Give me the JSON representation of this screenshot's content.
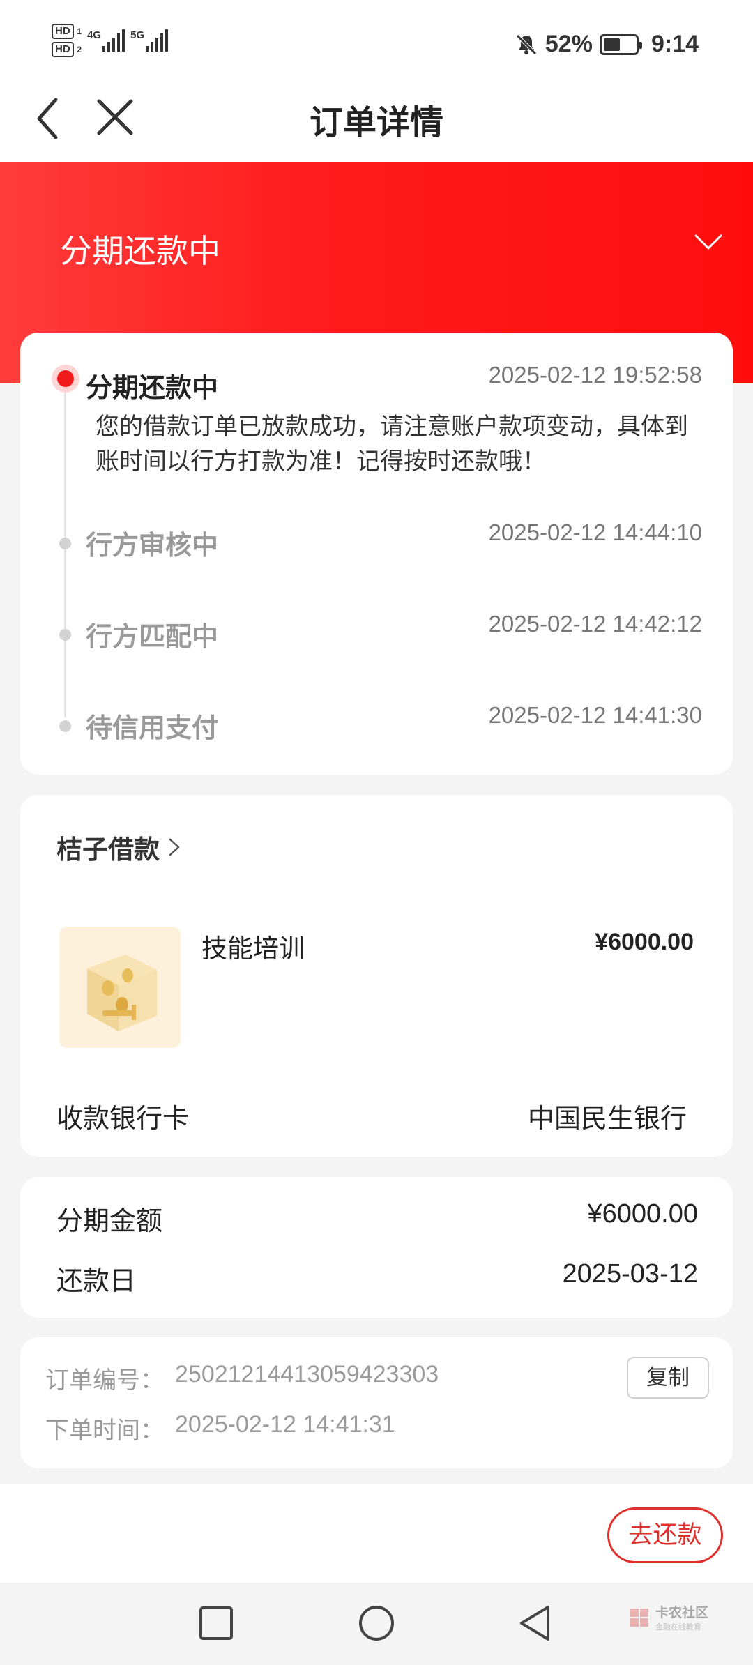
{
  "status_bar": {
    "hd1": "HD",
    "hd1_idx": "1",
    "hd2": "HD",
    "hd2_idx": "2",
    "net1": "4G",
    "net2": "5G",
    "battery": "52%",
    "time": "9:14"
  },
  "nav": {
    "title": "订单详情"
  },
  "hero": {
    "status": "分期还款中"
  },
  "timeline": [
    {
      "title": "分期还款中",
      "time": "2025-02-12 19:52:58",
      "desc": "您的借款订单已放款成功，请注意账户款项变动，具体到账时间以行方打款为准！记得按时还款哦！"
    },
    {
      "title": "行方审核中",
      "time": "2025-02-12 14:44:10"
    },
    {
      "title": "行方匹配中",
      "time": "2025-02-12 14:42:12"
    },
    {
      "title": "待信用支付",
      "time": "2025-02-12 14:41:30"
    }
  ],
  "product": {
    "merchant": "桔子借款",
    "name": "技能培训",
    "price": "¥6000.00",
    "bank_label": "收款银行卡",
    "bank_value": "中国民生银行"
  },
  "installment": {
    "amount_label": "分期金额",
    "amount_value": "¥6000.00",
    "due_label": "还款日",
    "due_value": "2025-03-12"
  },
  "order": {
    "number_label": "订单编号：",
    "number_value": "25021214413059423303",
    "time_label": "下单时间：",
    "time_value": "2025-02-12 14:41:31",
    "copy_label": "复制"
  },
  "actions": {
    "repay_label": "去还款"
  },
  "watermark": {
    "main": "卡农社区",
    "sub": "金融在线教育"
  }
}
